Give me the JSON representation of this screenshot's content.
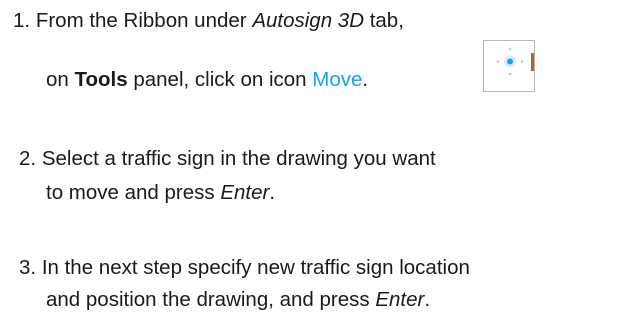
{
  "steps": [
    {
      "number": "1.",
      "line1_prefix": "From the Ribbon under ",
      "line1_tab": "Autosign 3D",
      "line1_suffix": " tab,",
      "line2_prefix": "on ",
      "line2_panel": "Tools",
      "line2_middle": " panel, click on icon ",
      "line2_command": "Move",
      "line2_suffix": "."
    },
    {
      "number": "2.",
      "line1": "Select a traffic sign in the drawing you want",
      "line2_prefix": "to move and press ",
      "line2_key": "Enter",
      "line2_suffix": "."
    },
    {
      "number": "3.",
      "line1": "In the next step specify new traffic sign location",
      "line2_prefix": "and position the drawing, and press ",
      "line2_key": "Enter",
      "line2_suffix": "."
    }
  ],
  "icon": {
    "name": "move-icon",
    "accent_color": "#1aa3e8",
    "arrow_color": "#c4cdd6",
    "bar_color": "#b5651d"
  },
  "colors": {
    "text": "#1a1a1a",
    "link": "#1aa3e8"
  }
}
